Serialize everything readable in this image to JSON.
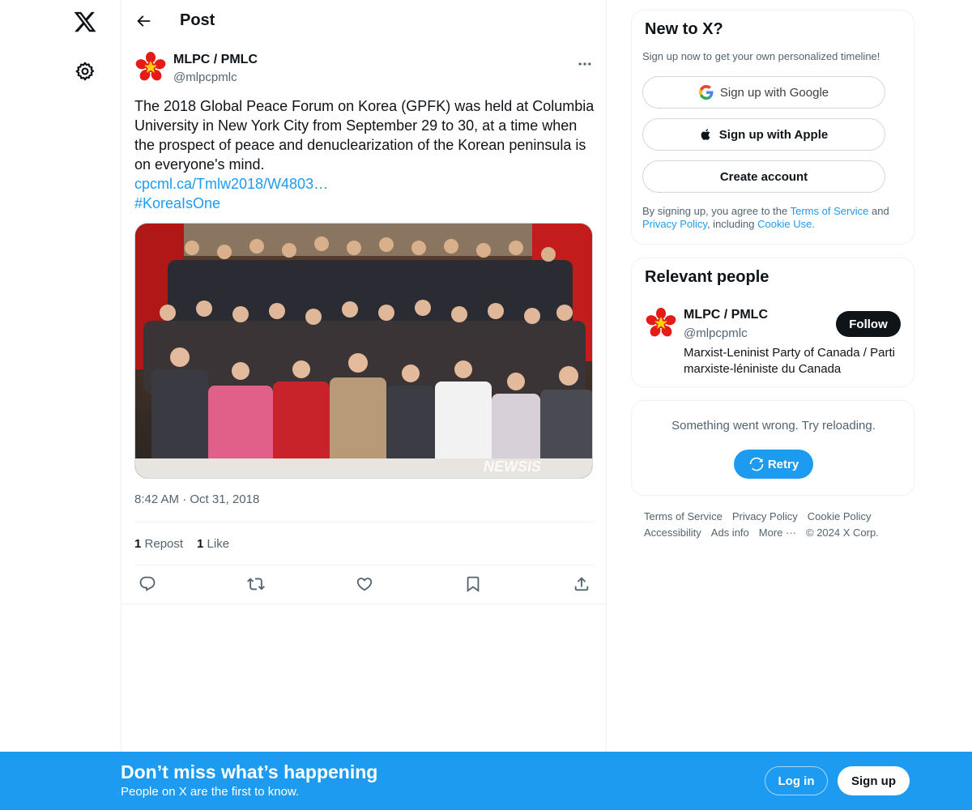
{
  "header": {
    "title": "Post"
  },
  "tweet": {
    "author_name": "MLPC / PMLC",
    "author_handle": "@mlpcpmlc",
    "text": "The 2018 Global Peace Forum on Korea (GPFK) was held at Columbia University in New York City from September 29 to 30, at a time when the prospect of peace and denuclearization of the Korean peninsula is on everyone's mind.",
    "link": "cpcml.ca/Tmlw2018/W4803…",
    "hashtag": "#KoreaIsOne",
    "media_watermark": "NEWSIS",
    "time": "8:42 AM",
    "separator": "·",
    "date": "Oct 31, 2018",
    "reposts_count": "1",
    "reposts_label": "Repost",
    "likes_count": "1",
    "likes_label": "Like"
  },
  "sidebar": {
    "new_to_x": {
      "title": "New to X?",
      "subtitle": "Sign up now to get your own personalized timeline!",
      "google_label": "Sign up with Google",
      "apple_label": "Sign up with Apple",
      "create_label": "Create account",
      "legal_prefix": "By signing up, you agree to the ",
      "terms": "Terms of Service",
      "and": " and ",
      "privacy": "Privacy Policy",
      "including": ", including ",
      "cookie": "Cookie Use."
    },
    "relevant": {
      "title": "Relevant people",
      "name": "MLPC / PMLC",
      "handle": "@mlpcpmlc",
      "bio": "Marxist-Leninist Party of Canada / Parti marxiste-léniniste du Canada",
      "follow_label": "Follow"
    },
    "error": {
      "message": "Something went wrong. Try reloading.",
      "retry_label": "Retry"
    },
    "footer": {
      "terms": "Terms of Service",
      "privacy": "Privacy Policy",
      "cookie": "Cookie Policy",
      "accessibility": "Accessibility",
      "ads": "Ads info",
      "more": "More ···",
      "copyright": "© 2024 X Corp."
    }
  },
  "bottom_bar": {
    "title": "Don’t miss what’s happening",
    "subtitle": "People on X are the first to know.",
    "login_label": "Log in",
    "signup_label": "Sign up"
  },
  "colors": {
    "accent": "#1d9bf0",
    "text": "#0f1419",
    "muted": "#536471",
    "logo_red": "#e41b17",
    "logo_yellow": "#ffd400"
  }
}
